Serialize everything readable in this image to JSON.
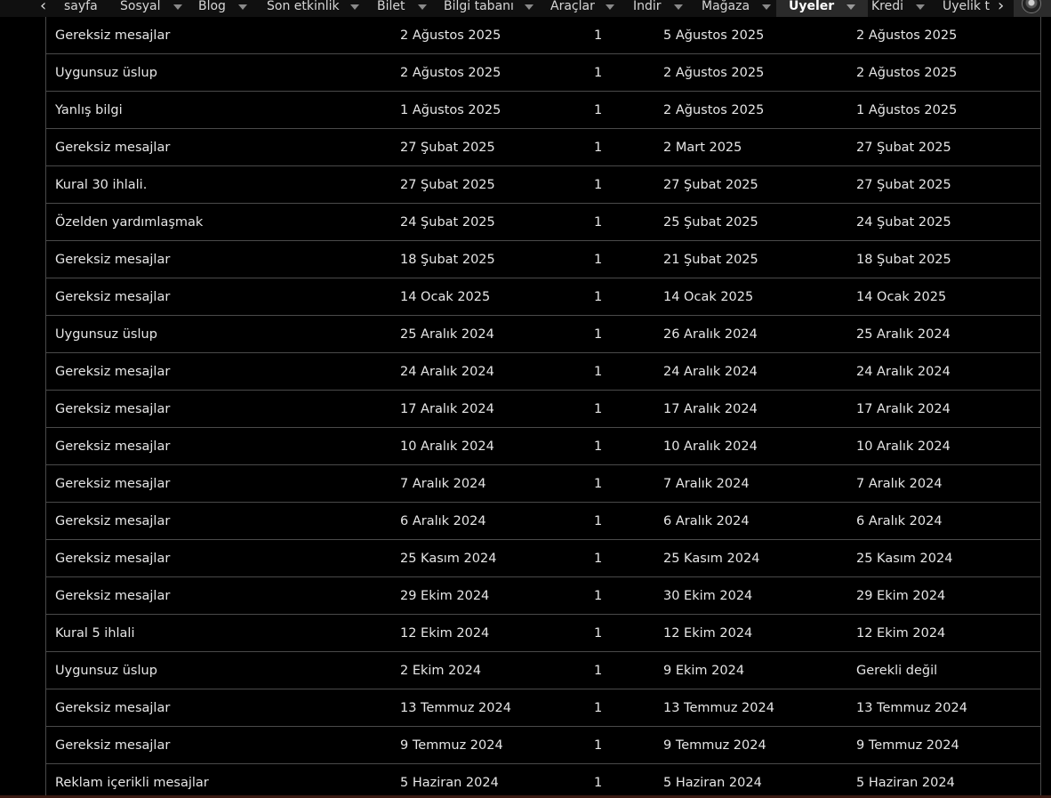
{
  "nav": {
    "items": [
      {
        "label": "sayfa",
        "caret": false
      },
      {
        "label": "Sosyal",
        "caret": true
      },
      {
        "label": "Blog",
        "caret": true
      },
      {
        "label": "Son etkinlik",
        "caret": true
      },
      {
        "label": "Bilet",
        "caret": true
      },
      {
        "label": "Bilgi tabanı",
        "caret": true
      },
      {
        "label": "Araçlar",
        "caret": true
      },
      {
        "label": "İndir",
        "caret": true
      },
      {
        "label": "Mağaza",
        "caret": true
      },
      {
        "label": "Üyeler",
        "caret": true,
        "active": true
      },
      {
        "label": "Kredi",
        "caret": true
      },
      {
        "label": "Üyelik t",
        "caret": false
      }
    ],
    "left_arrow": "‹",
    "right_arrow": "›"
  },
  "table": {
    "rows": [
      {
        "reason": "Gereksiz mesajlar",
        "date": "2 Ağustos 2025",
        "points": "1",
        "expiry": "5 Ağustos 2025",
        "end": "2 Ağustos 2025"
      },
      {
        "reason": "Uygunsuz üslup",
        "date": "2 Ağustos 2025",
        "points": "1",
        "expiry": "2 Ağustos 2025",
        "end": "2 Ağustos 2025"
      },
      {
        "reason": "Yanlış bilgi",
        "date": "1 Ağustos 2025",
        "points": "1",
        "expiry": "2 Ağustos 2025",
        "end": "1 Ağustos 2025"
      },
      {
        "reason": "Gereksiz mesajlar",
        "date": "27 Şubat 2025",
        "points": "1",
        "expiry": "2 Mart 2025",
        "end": "27 Şubat 2025"
      },
      {
        "reason": "Kural 30 ihlali.",
        "date": "27 Şubat 2025",
        "points": "1",
        "expiry": "27 Şubat 2025",
        "end": "27 Şubat 2025"
      },
      {
        "reason": "Özelden yardımlaşmak",
        "date": "24 Şubat 2025",
        "points": "1",
        "expiry": "25 Şubat 2025",
        "end": "24 Şubat 2025"
      },
      {
        "reason": "Gereksiz mesajlar",
        "date": "18 Şubat 2025",
        "points": "1",
        "expiry": "21 Şubat 2025",
        "end": "18 Şubat 2025"
      },
      {
        "reason": "Gereksiz mesajlar",
        "date": "14 Ocak 2025",
        "points": "1",
        "expiry": "14 Ocak 2025",
        "end": "14 Ocak 2025"
      },
      {
        "reason": "Uygunsuz üslup",
        "date": "25 Aralık 2024",
        "points": "1",
        "expiry": "26 Aralık 2024",
        "end": "25 Aralık 2024"
      },
      {
        "reason": "Gereksiz mesajlar",
        "date": "24 Aralık 2024",
        "points": "1",
        "expiry": "24 Aralık 2024",
        "end": "24 Aralık 2024"
      },
      {
        "reason": "Gereksiz mesajlar",
        "date": "17 Aralık 2024",
        "points": "1",
        "expiry": "17 Aralık 2024",
        "end": "17 Aralık 2024"
      },
      {
        "reason": "Gereksiz mesajlar",
        "date": "10 Aralık 2024",
        "points": "1",
        "expiry": "10 Aralık 2024",
        "end": "10 Aralık 2024"
      },
      {
        "reason": "Gereksiz mesajlar",
        "date": "7 Aralık 2024",
        "points": "1",
        "expiry": "7 Aralık 2024",
        "end": "7 Aralık 2024"
      },
      {
        "reason": "Gereksiz mesajlar",
        "date": "6 Aralık 2024",
        "points": "1",
        "expiry": "6 Aralık 2024",
        "end": "6 Aralık 2024"
      },
      {
        "reason": "Gereksiz mesajlar",
        "date": "25 Kasım 2024",
        "points": "1",
        "expiry": "25 Kasım 2024",
        "end": "25 Kasım 2024"
      },
      {
        "reason": "Gereksiz mesajlar",
        "date": "29 Ekim 2024",
        "points": "1",
        "expiry": "30 Ekim 2024",
        "end": "29 Ekim 2024"
      },
      {
        "reason": "Kural 5 ihlali",
        "date": "12 Ekim 2024",
        "points": "1",
        "expiry": "12 Ekim 2024",
        "end": "12 Ekim 2024"
      },
      {
        "reason": "Uygunsuz üslup",
        "date": "2 Ekim 2024",
        "points": "1",
        "expiry": "9 Ekim 2024",
        "end": "Gerekli değil"
      },
      {
        "reason": "Gereksiz mesajlar",
        "date": "13 Temmuz 2024",
        "points": "1",
        "expiry": "13 Temmuz 2024",
        "end": "13 Temmuz 2024"
      },
      {
        "reason": "Gereksiz mesajlar",
        "date": "9 Temmuz 2024",
        "points": "1",
        "expiry": "9 Temmuz 2024",
        "end": "9 Temmuz 2024"
      },
      {
        "reason": "Reklam içerikli mesajlar",
        "date": "5 Haziran 2024",
        "points": "1",
        "expiry": "5 Haziran 2024",
        "end": "5 Haziran 2024"
      }
    ]
  }
}
